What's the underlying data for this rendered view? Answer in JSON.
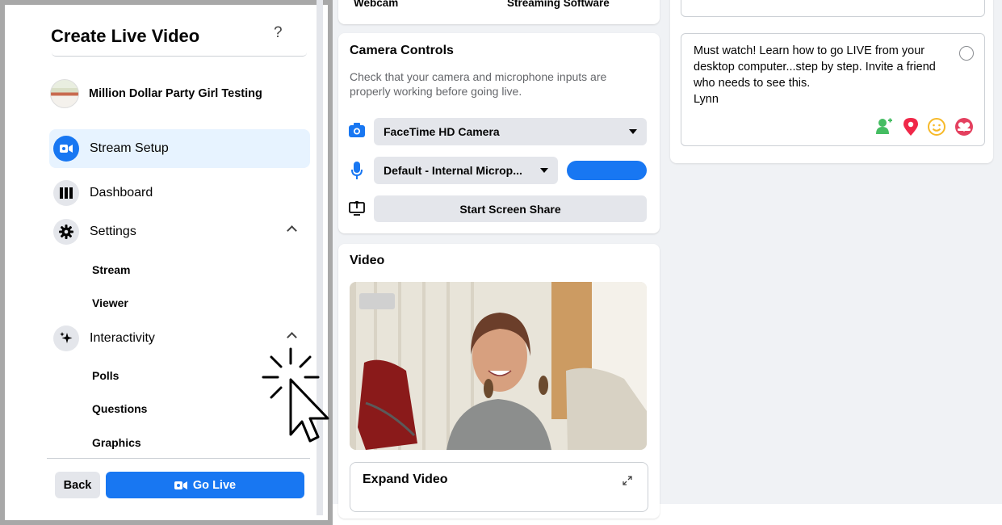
{
  "sidebar": {
    "title": "Create Live Video",
    "help_label": "?",
    "page_name": "Million Dollar Party Girl Testing",
    "nav": {
      "stream_setup": "Stream Setup",
      "dashboard": "Dashboard",
      "settings": "Settings",
      "interactivity": "Interactivity"
    },
    "settings_items": [
      "Stream",
      "Viewer"
    ],
    "interactivity_items": [
      "Polls",
      "Questions",
      "Graphics"
    ],
    "back_label": "Back",
    "go_live_label": "Go Live"
  },
  "source_tabs": {
    "webcam": "Webcam",
    "streaming_software": "Streaming Software"
  },
  "camera_controls": {
    "title": "Camera Controls",
    "description": "Check that your camera and microphone inputs are properly working before going live.",
    "camera_value": "FaceTime HD Camera",
    "mic_value": "Default - Internal Microp...",
    "share_label": "Start Screen Share"
  },
  "video": {
    "title": "Video",
    "expand_label": "Expand Video"
  },
  "post": {
    "text": "Must watch! Learn how to go LIVE from your desktop computer...step by step. Invite a friend who needs to see this.\nLynn"
  },
  "colors": {
    "accent": "#1877f2",
    "active_bg": "#e7f3ff",
    "frame_border": "#a8a8a8"
  }
}
